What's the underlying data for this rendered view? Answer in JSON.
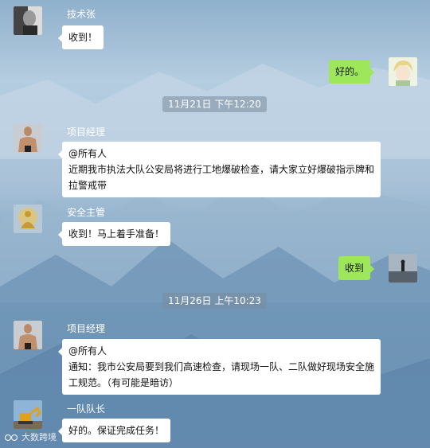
{
  "messages": [
    {
      "sender": "技术张",
      "text": "收到！"
    },
    {
      "mine": "好的。"
    },
    {
      "timestamp": "11月21日 下午12:20"
    },
    {
      "sender": "项目经理",
      "lines": [
        "@所有人",
        "近期我市执法大队公安局将进行工地爆破检查，请大家立好爆破指示牌和",
        "拉警戒带"
      ]
    },
    {
      "sender": "安全主管",
      "text": "收到！马上着手准备！"
    },
    {
      "mine": "收到"
    },
    {
      "timestamp": "11月26日 上午10:23"
    },
    {
      "sender": "项目经理",
      "lines": [
        "@所有人",
        "通知：我市公安局要到我们高速检查，请现场一队、二队做好现场安全施",
        "工规范。（有可能是暗访）"
      ]
    },
    {
      "sender": "一队队长",
      "text": "好的。保证完成任务！"
    }
  ],
  "watermark": "大数跨境",
  "colors": {
    "my_bubble": "#9ee75a",
    "other_bubble": "#ffffff",
    "timestamp_bg": "rgba(120,140,160,0.55)"
  },
  "avatars": [
    "man-portrait-avatar",
    "anime-boy-avatar",
    "shirtless-man-avatar",
    "golden-buddha-avatar",
    "person-on-cliff-avatar",
    "excavator-avatar"
  ]
}
